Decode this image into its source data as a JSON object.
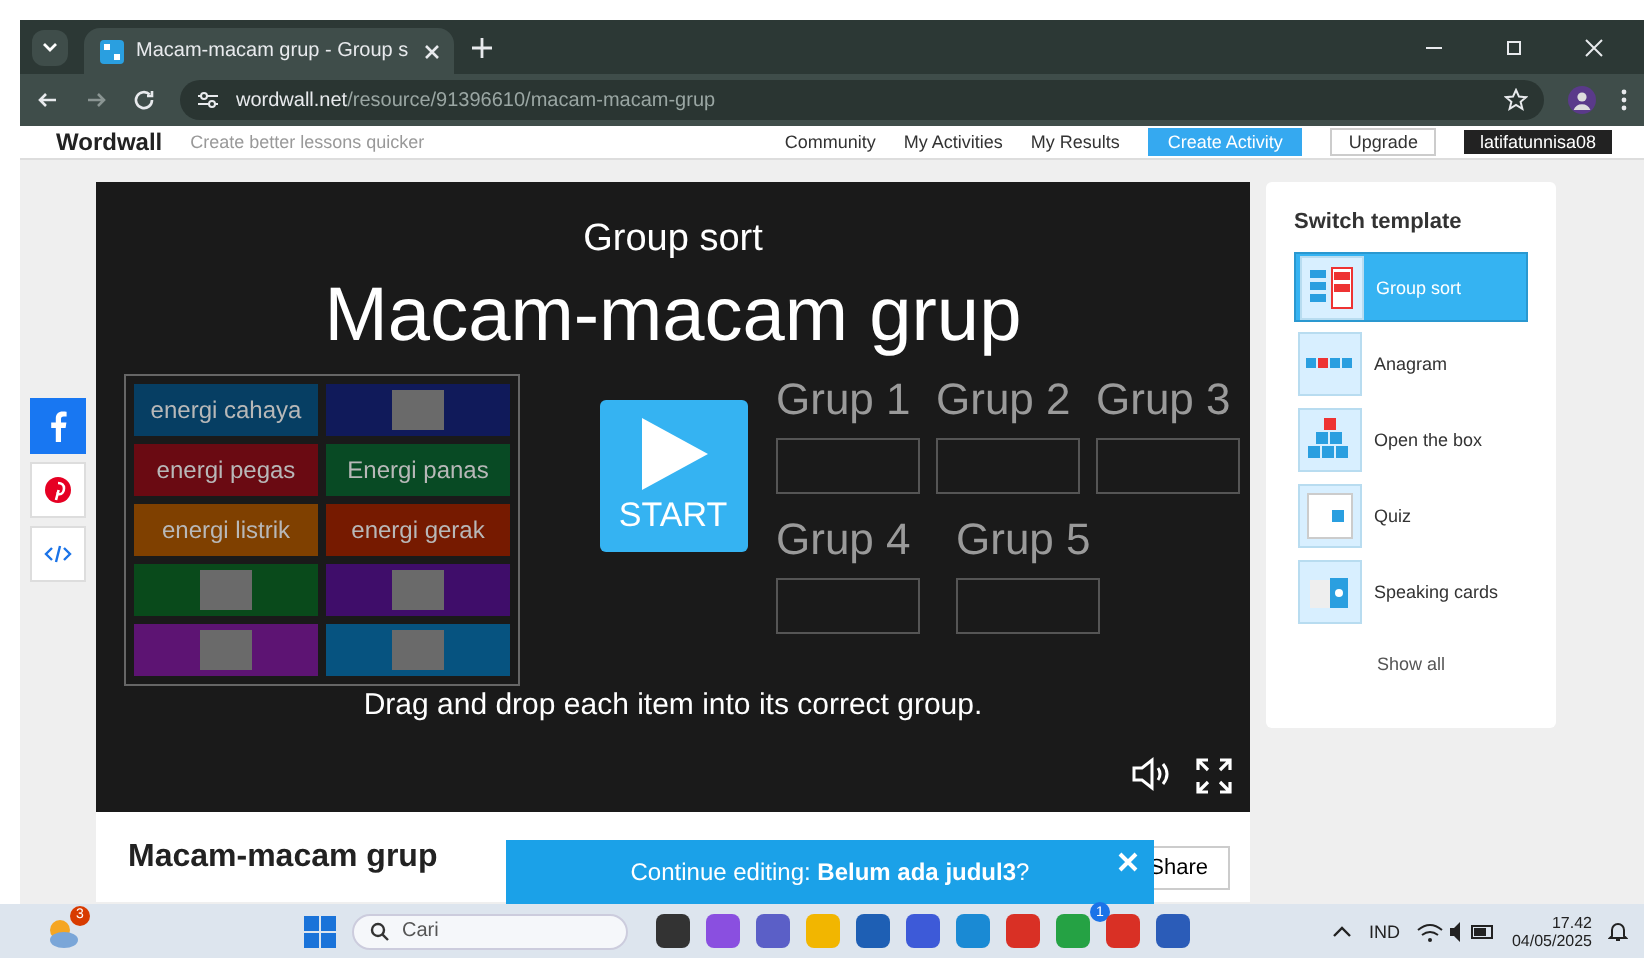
{
  "browser": {
    "tab_title": "Macam-macam grup - Group s",
    "url_domain": "wordwall.net",
    "url_path": "/resource/91396610/macam-macam-grup"
  },
  "site_header": {
    "logo": "Wordwall",
    "tagline": "Create better lessons quicker",
    "nav": [
      "Community",
      "My Activities",
      "My Results"
    ],
    "create_button": "Create Activity",
    "upgrade_button": "Upgrade",
    "user": "latifatunnisa08"
  },
  "share_sidebar": [
    {
      "kind": "facebook"
    },
    {
      "kind": "pinterest"
    },
    {
      "kind": "embed"
    }
  ],
  "game": {
    "template": "Group sort",
    "title": "Macam-macam grup",
    "start": "START",
    "instruction": "Drag and drop each item into its correct group.",
    "items": [
      {
        "kind": "text",
        "label": "energi cahaya",
        "color": "#063e63"
      },
      {
        "kind": "image",
        "color": "#101a5a"
      },
      {
        "kind": "text",
        "label": "energi pegas",
        "color": "#6a0a12"
      },
      {
        "kind": "text",
        "label": "Energi panas",
        "color": "#084a24"
      },
      {
        "kind": "text",
        "label": "energi listrik",
        "color": "#7f4000"
      },
      {
        "kind": "text",
        "label": "energi gerak",
        "color": "#761a00"
      },
      {
        "kind": "image",
        "color": "#094a1b"
      },
      {
        "kind": "image",
        "color": "#3f0d6a"
      },
      {
        "kind": "image",
        "color": "#5d1473"
      },
      {
        "kind": "image",
        "color": "#065380"
      }
    ],
    "groups": [
      "Grup 1",
      "Grup 2",
      "Grup 3",
      "Grup 4",
      "Grup 5"
    ]
  },
  "templates": {
    "title": "Switch template",
    "items": [
      {
        "label": "Group sort",
        "selected": true
      },
      {
        "label": "Anagram",
        "selected": false
      },
      {
        "label": "Open the box",
        "selected": false
      },
      {
        "label": "Quiz",
        "selected": false
      },
      {
        "label": "Speaking cards",
        "selected": false
      }
    ],
    "show_all": "Show all"
  },
  "activity_title": "Macam-macam grup",
  "share_button": "Share",
  "toast": {
    "text": "Continue editing: **Belum ada judul3**?"
  },
  "taskbar": {
    "weather_badge": "3",
    "search_placeholder": "Cari",
    "apps": [
      {
        "kind": "taskview"
      },
      {
        "kind": "copilot"
      },
      {
        "kind": "teams"
      },
      {
        "kind": "files"
      },
      {
        "kind": "store"
      },
      {
        "kind": "app"
      },
      {
        "kind": "edge"
      },
      {
        "kind": "chrome"
      },
      {
        "kind": "whatsapp",
        "badge": "1"
      },
      {
        "kind": "chrome"
      },
      {
        "kind": "word"
      }
    ],
    "language": "IND",
    "time": "17.42",
    "date": "04/05/2025"
  }
}
